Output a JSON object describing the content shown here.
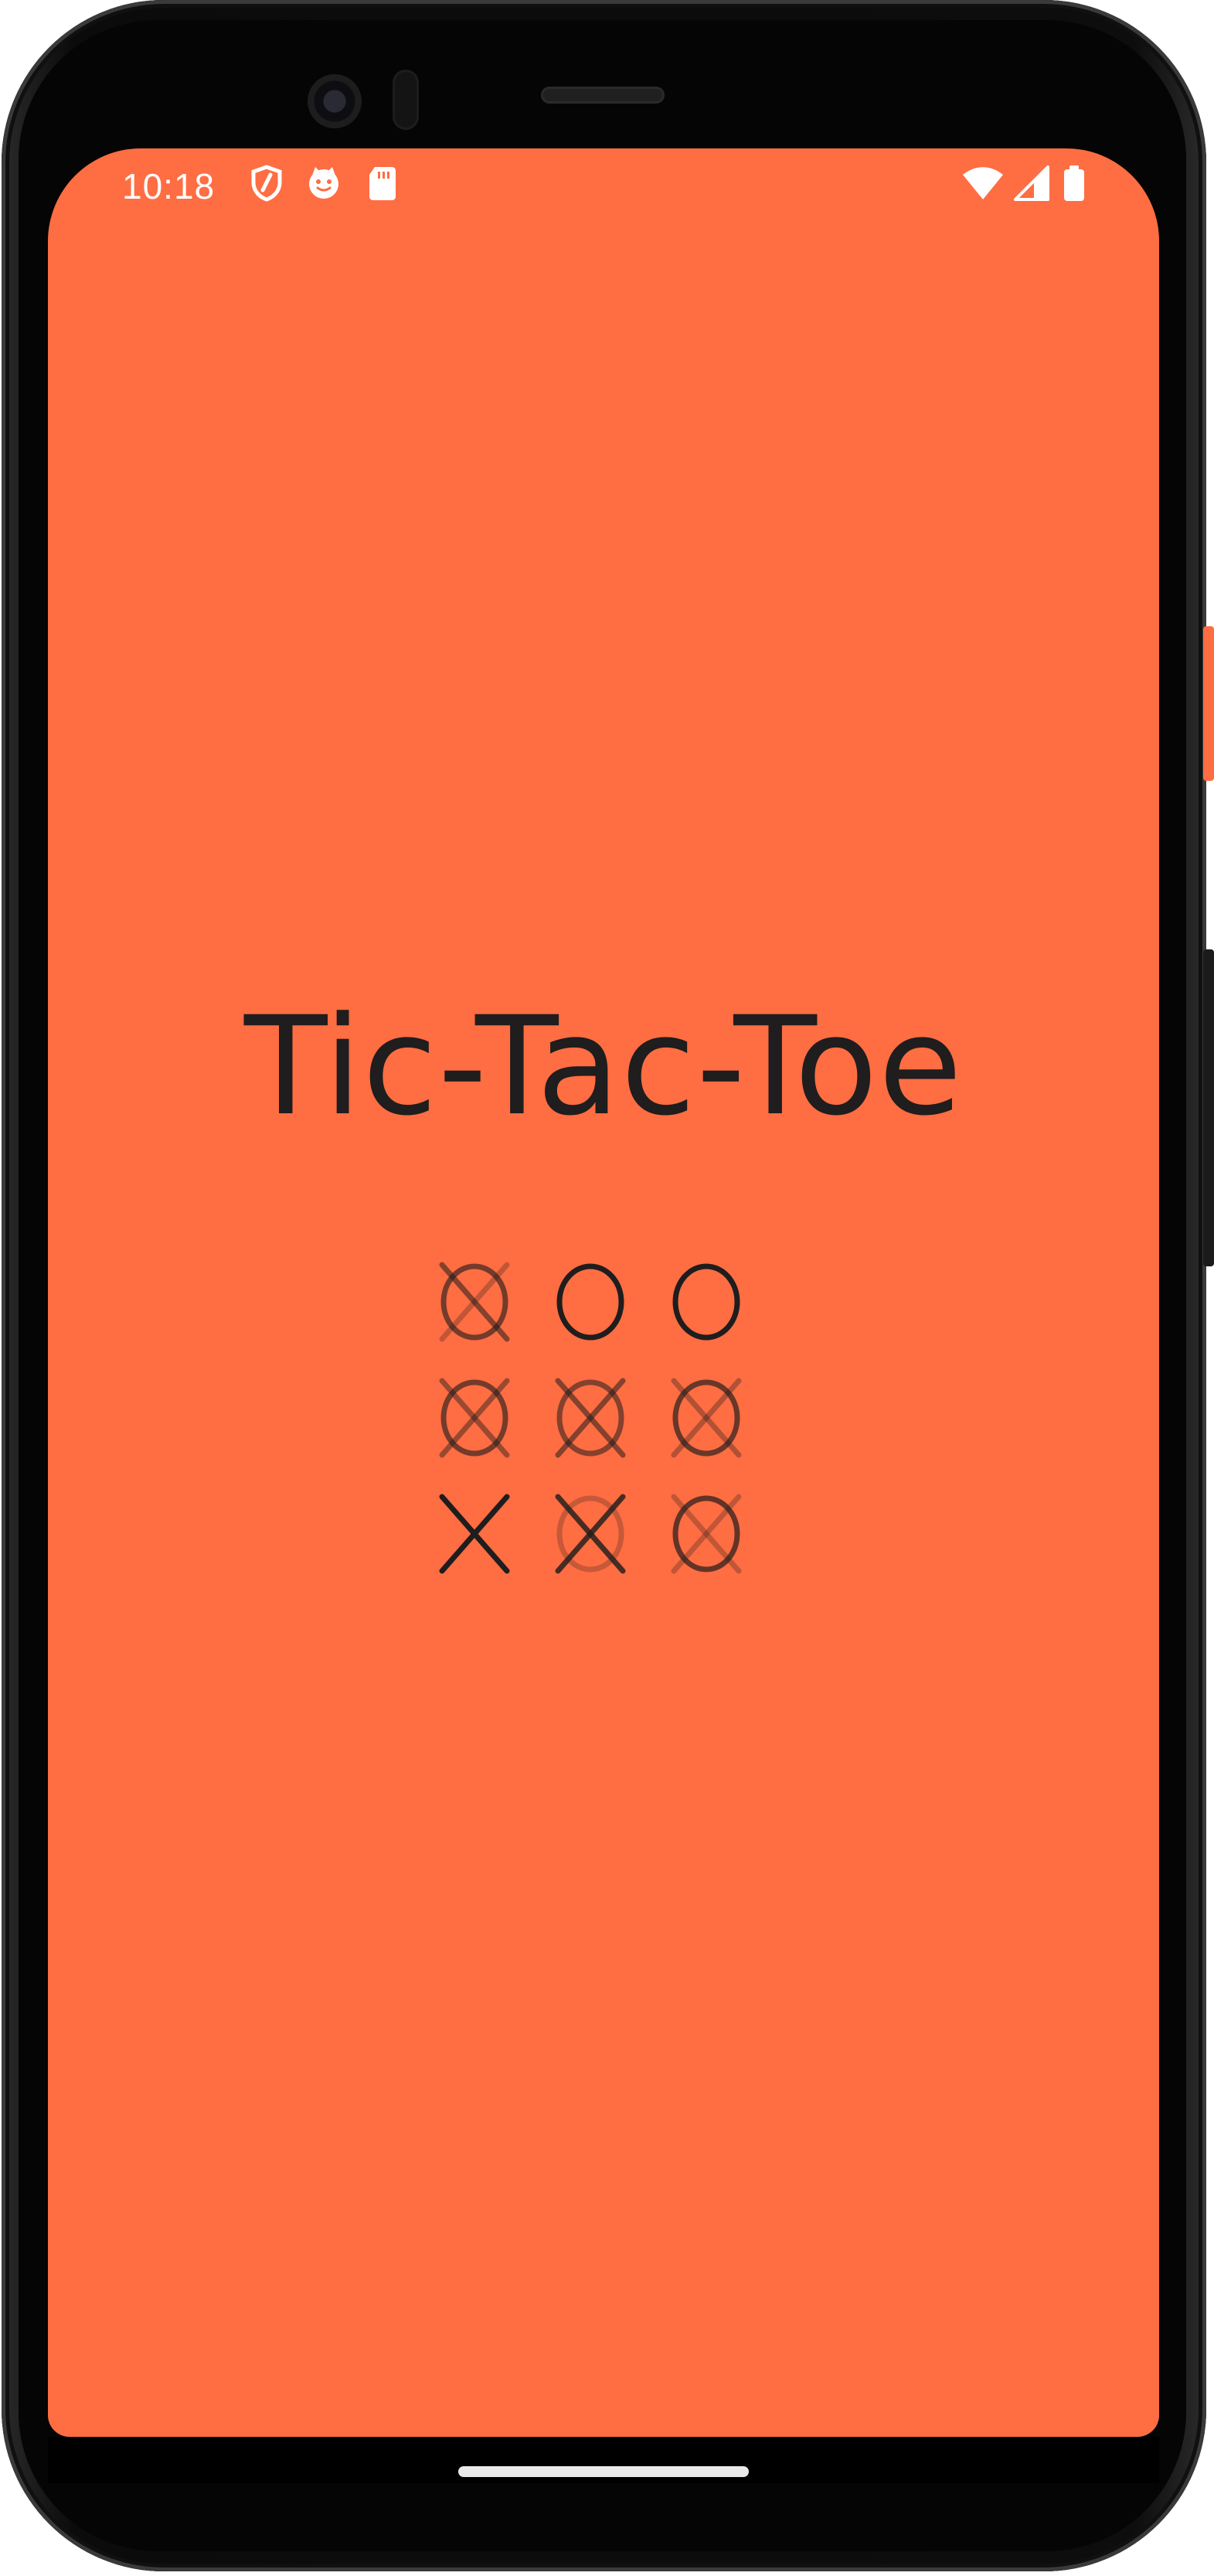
{
  "status_bar": {
    "time": "10:18",
    "left_icons": [
      "shield-icon",
      "cat-face-icon",
      "sd-card-icon"
    ],
    "right_icons": [
      "wifi-icon",
      "cell-signal-icon",
      "battery-icon"
    ]
  },
  "app": {
    "title": "Tic-Tac-Toe",
    "background_color": "#ff6d42",
    "text_color": "#1f1d1d"
  },
  "board": {
    "cells": [
      {
        "row": 1,
        "col": 1,
        "glyph": "X and O overlapped (animating)"
      },
      {
        "row": 1,
        "col": 2,
        "glyph": "O"
      },
      {
        "row": 1,
        "col": 3,
        "glyph": "O"
      },
      {
        "row": 2,
        "col": 1,
        "glyph": "X and O overlapped (animating)"
      },
      {
        "row": 2,
        "col": 2,
        "glyph": "X and O overlapped (animating)"
      },
      {
        "row": 2,
        "col": 3,
        "glyph": "X and O overlapped (animating)"
      },
      {
        "row": 3,
        "col": 1,
        "glyph": "X"
      },
      {
        "row": 3,
        "col": 2,
        "glyph": "X and O overlapped (animating)"
      },
      {
        "row": 3,
        "col": 3,
        "glyph": "X and O overlapped (animating)"
      }
    ]
  },
  "navigation": {
    "home_indicator": "home-pill"
  }
}
